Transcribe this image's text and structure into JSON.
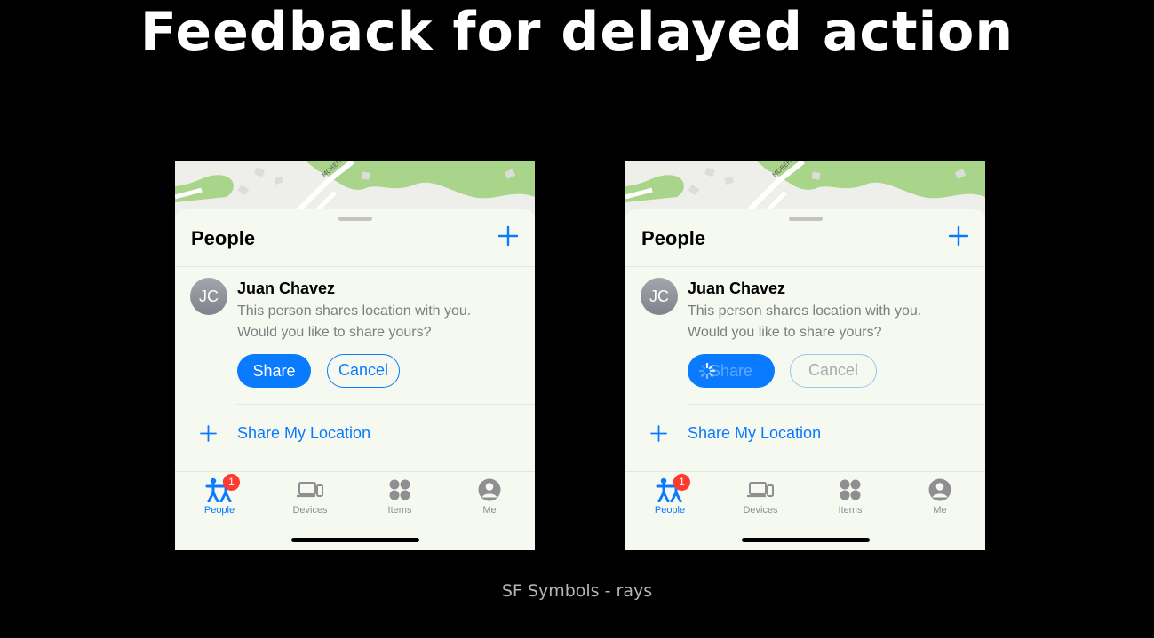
{
  "slide": {
    "title": "Feedback for delayed action",
    "caption": "SF Symbols - rays"
  },
  "phones": [
    {
      "sheet_title": "People",
      "avatar_initials": "JC",
      "person_name": "Juan Chavez",
      "message_line1": "This person shares location with you.",
      "message_line2": "Would you like to share yours?",
      "share_label": "Share",
      "cancel_label": "Cancel",
      "share_my_location": "Share My Location",
      "state": "idle"
    },
    {
      "sheet_title": "People",
      "avatar_initials": "JC",
      "person_name": "Juan Chavez",
      "message_line1": "This person shares location with you.",
      "message_line2": "Would you like to share yours?",
      "share_label": "Share",
      "cancel_label": "Cancel",
      "share_my_location": "Share My Location",
      "state": "loading"
    }
  ],
  "map": {
    "street_label": "MOREH"
  },
  "tabs": [
    {
      "label": "People",
      "icon": "people-icon",
      "badge": "1",
      "active": true
    },
    {
      "label": "Devices",
      "icon": "devices-icon"
    },
    {
      "label": "Items",
      "icon": "items-icon"
    },
    {
      "label": "Me",
      "icon": "me-icon"
    }
  ],
  "colors": {
    "accent": "#0a7aff",
    "badge": "#ff3b30",
    "sheet_background": "#f5f9ef",
    "map_land": "#eeeeea",
    "map_park": "#a8d58a"
  }
}
